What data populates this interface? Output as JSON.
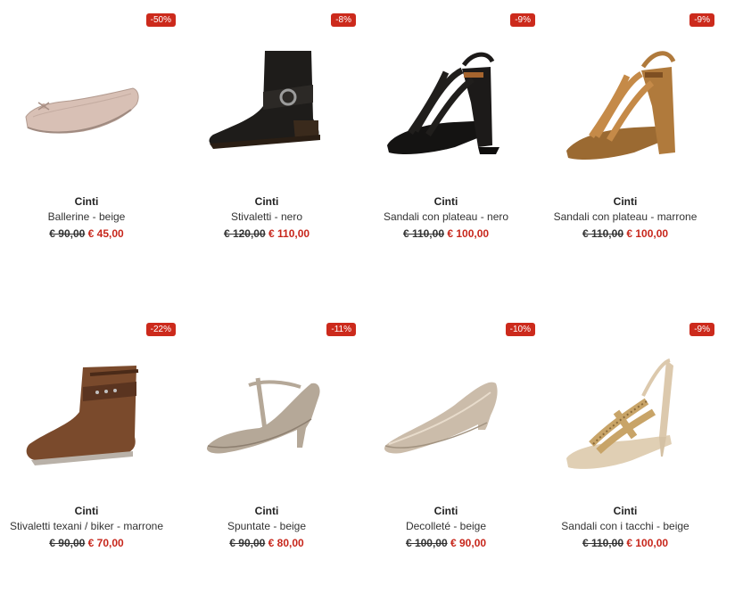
{
  "products": [
    {
      "brand": "Cinti",
      "name": "Ballerine - beige",
      "old_price": "€ 90,00",
      "price": "€ 45,00",
      "discount": "-50%",
      "icon": "ballerina-shoe",
      "color": "#d9c2b8"
    },
    {
      "brand": "Cinti",
      "name": "Stivaletti - nero",
      "old_price": "€ 120,00",
      "price": "€ 110,00",
      "discount": "-8%",
      "icon": "ankle-boot",
      "color": "#1c1a18"
    },
    {
      "brand": "Cinti",
      "name": "Sandali con plateau - nero",
      "old_price": "€ 110,00",
      "price": "€ 100,00",
      "discount": "-9%",
      "icon": "platform-sandal",
      "color": "#161514"
    },
    {
      "brand": "Cinti",
      "name": "Sandali con plateau - marrone",
      "old_price": "€ 110,00",
      "price": "€ 100,00",
      "discount": "-9%",
      "icon": "platform-sandal",
      "color": "#b07a3c"
    },
    {
      "brand": "Cinti",
      "name": "Stivaletti texani / biker - marrone",
      "old_price": "€ 90,00",
      "price": "€ 70,00",
      "discount": "-22%",
      "icon": "biker-boot",
      "color": "#7a4a2c"
    },
    {
      "brand": "Cinti",
      "name": "Spuntate - beige",
      "old_price": "€ 90,00",
      "price": "€ 80,00",
      "discount": "-11%",
      "icon": "t-strap-shoe",
      "color": "#b9ab9b"
    },
    {
      "brand": "Cinti",
      "name": "Decolleté - beige",
      "old_price": "€ 100,00",
      "price": "€ 90,00",
      "discount": "-10%",
      "icon": "pump-shoe",
      "color": "#cbbcaa"
    },
    {
      "brand": "Cinti",
      "name": "Sandali con i tacchi - beige",
      "old_price": "€ 110,00",
      "price": "€ 100,00",
      "discount": "-9%",
      "icon": "heel-sandal",
      "color": "#e4d4bb"
    }
  ]
}
